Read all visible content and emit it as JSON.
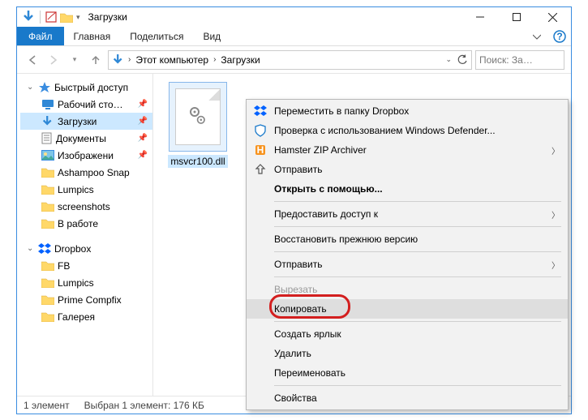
{
  "titlebar": {
    "title": "Загрузки"
  },
  "ribbon": {
    "file": "Файл",
    "tabs": [
      "Главная",
      "Поделиться",
      "Вид"
    ]
  },
  "nav": {
    "crumbs": [
      "Этот компьютер",
      "Загрузки"
    ],
    "search_placeholder": "Поиск: За…"
  },
  "sidebar": {
    "quick": {
      "label": "Быстрый доступ",
      "items": [
        {
          "label": "Рабочий сто…",
          "icon": "desktop",
          "pin": true
        },
        {
          "label": "Загрузки",
          "icon": "downloads",
          "pin": true,
          "selected": true
        },
        {
          "label": "Документы",
          "icon": "documents",
          "pin": true
        },
        {
          "label": "Изображени",
          "icon": "pictures",
          "pin": true
        },
        {
          "label": "Ashampoo Snap",
          "icon": "folder"
        },
        {
          "label": "Lumpics",
          "icon": "folder"
        },
        {
          "label": "screenshots",
          "icon": "folder"
        },
        {
          "label": "В работе",
          "icon": "folder"
        }
      ]
    },
    "dropbox": {
      "label": "Dropbox",
      "items": [
        {
          "label": "FB",
          "icon": "folder"
        },
        {
          "label": "Lumpics",
          "icon": "folder"
        },
        {
          "label": "Prime Compfix",
          "icon": "folder"
        },
        {
          "label": "Галерея",
          "icon": "folder"
        }
      ]
    }
  },
  "file": {
    "name": "msvcr100.dll"
  },
  "status": {
    "count": "1 элемент",
    "selection": "Выбран 1 элемент: 176 КБ"
  },
  "ctx": {
    "items": [
      {
        "icon": "dropbox",
        "label": "Переместить в папку Dropbox"
      },
      {
        "icon": "defender",
        "label": "Проверка с использованием Windows Defender..."
      },
      {
        "icon": "hamster",
        "label": "Hamster ZIP Archiver",
        "submenu": true
      },
      {
        "icon": "share",
        "label": "Отправить"
      },
      {
        "label": "Открыть с помощью...",
        "bold": true
      },
      {
        "sep": true
      },
      {
        "label": "Предоставить доступ к",
        "submenu": true
      },
      {
        "sep": true
      },
      {
        "label": "Восстановить прежнюю версию"
      },
      {
        "sep": true
      },
      {
        "label": "Отправить",
        "submenu": true
      },
      {
        "sep": true
      },
      {
        "label": "Вырезать",
        "disabled": true
      },
      {
        "label": "Копировать",
        "highlight": true
      },
      {
        "sep": true
      },
      {
        "label": "Создать ярлык"
      },
      {
        "label": "Удалить"
      },
      {
        "label": "Переименовать"
      },
      {
        "sep": true
      },
      {
        "label": "Свойства"
      }
    ]
  }
}
